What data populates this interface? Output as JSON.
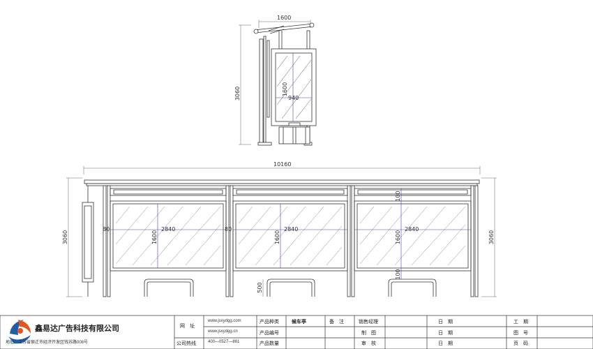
{
  "dimensions": {
    "side_width": "1600",
    "side_height": "3060",
    "side_panel_height": "1600",
    "side_panel_width": "940",
    "total_width": "10160",
    "front_height_left": "3060",
    "front_height_right": "3060",
    "panel_width": "2840",
    "panel_height": "1600",
    "left_gap": "80",
    "mid_gap": "80",
    "top_gap": "100",
    "bottom_gap": "100",
    "bench_height": "500"
  },
  "title_block": {
    "company": "鑫易达广告科技有限公司",
    "address": "地址：江苏省宿迁市经济开发区钱苏路008号",
    "labels": {
      "website": "网　址",
      "hotline": "公司热线",
      "product_type": "产品种类",
      "product_no": "产品编号",
      "product_qty": "产品数量",
      "remarks": "备　注",
      "sales_manager": "销售经理",
      "drawing": "制　图",
      "review": "审　核",
      "date1": "日　期",
      "date2": "日　期",
      "date3": "日　期",
      "work_period": "工　期",
      "drawing_no": "图　号",
      "page_no": "页　码"
    },
    "website_1": "www.jsxydgg.com",
    "website_2": "www.jsxydgg.cn",
    "hotline_value": "400—0527—861",
    "product_type_value": "候车亭"
  },
  "colors": {
    "line": "#333333",
    "dimension": "#4a3fc0",
    "logo_blue": "#1f5fa8",
    "logo_orange": "#e2581c"
  }
}
